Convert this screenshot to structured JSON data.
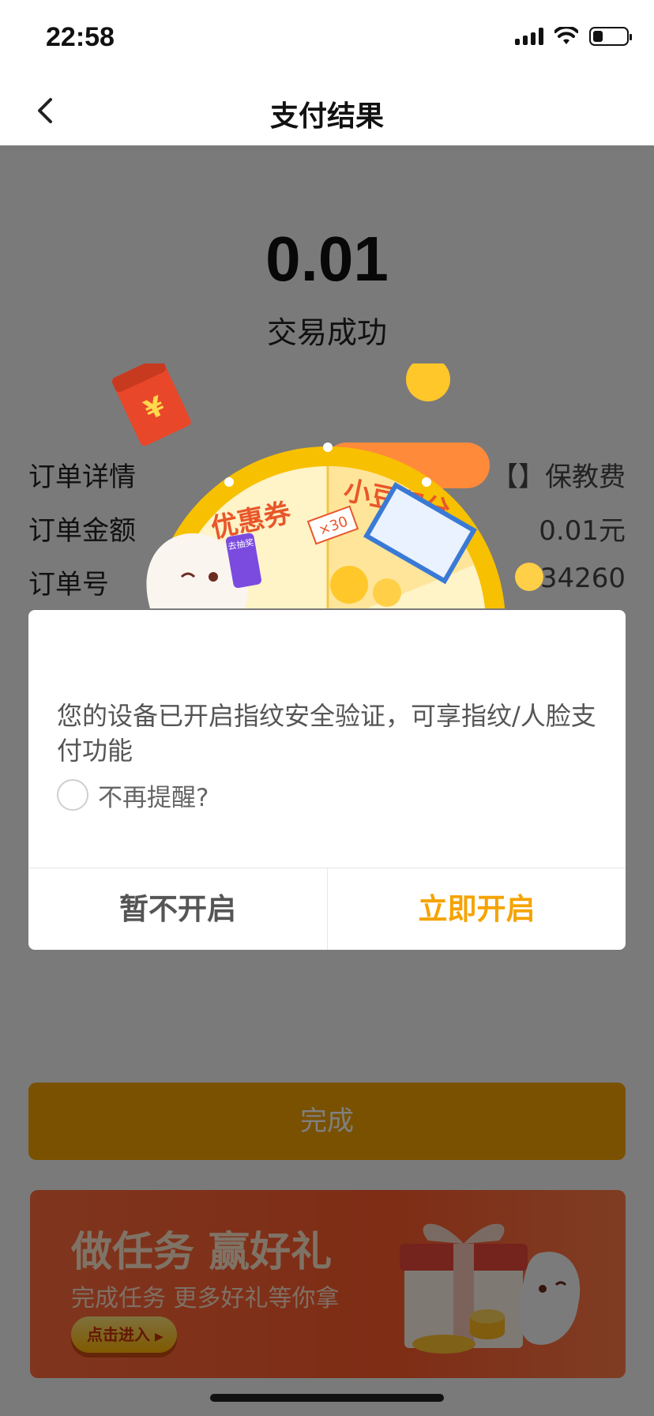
{
  "status_bar": {
    "time": "22:58"
  },
  "nav": {
    "title": "支付结果"
  },
  "payment": {
    "amount": "0.01",
    "status": "交易成功"
  },
  "details": [
    {
      "label": "订单详情",
      "value": "【】保教费"
    },
    {
      "label": "订单金额",
      "value": "0.01元"
    },
    {
      "label": "订单号",
      "value": "334260"
    }
  ],
  "done_label": "完成",
  "promo": {
    "coupon_text": "优惠券",
    "beans_text": "小豆积分",
    "ticket_text": "×30",
    "phone_text": "去抽奖"
  },
  "banner": {
    "title": "做任务 赢好礼",
    "subtitle": "完成任务 更多好礼等你拿",
    "button": "点击进入"
  },
  "dialog": {
    "message": "您的设备已开启指纹安全验证，可享指纹/人脸支付功能",
    "remember_label": "不再提醒?",
    "cancel_label": "暂不开启",
    "confirm_label": "立即开启"
  },
  "colors": {
    "accent": "#f5a300",
    "banner": "#ff5a2a"
  }
}
